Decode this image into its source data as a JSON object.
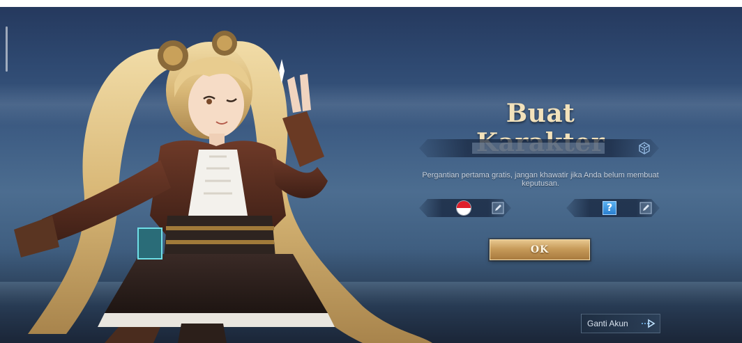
{
  "dialog": {
    "title": "Buat Karakter",
    "name_input": {
      "value": "",
      "placeholder": ""
    },
    "hint": "Pergantian pertama gratis, jangan khawatir jika Anda belum membuat keputusan.",
    "ok_label": "OK"
  },
  "region": {
    "flag_icon": "indonesia-flag-icon",
    "edit_icon": "edit-icon"
  },
  "avatar": {
    "placeholder_symbol": "?",
    "edit_icon": "edit-icon"
  },
  "footer": {
    "switch_account_label": "Ganti Akun",
    "switch_icon": "switch-arrow-icon"
  },
  "colors": {
    "title": "#f3e2bb",
    "ok_button": "#c79b5a",
    "flag_red": "#e01f2a"
  }
}
